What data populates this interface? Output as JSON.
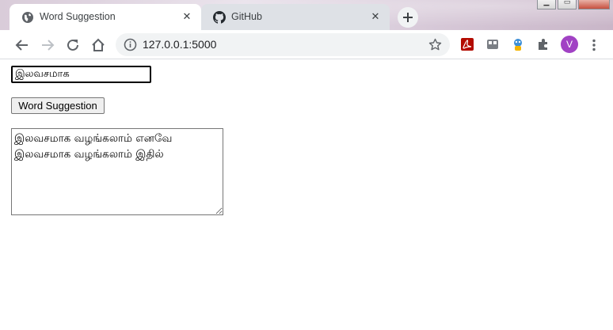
{
  "browser": {
    "tabs": [
      {
        "title": "Word Suggestion",
        "icon": "globe-icon",
        "active": true,
        "close": "✕"
      },
      {
        "title": "GitHub",
        "icon": "github-icon",
        "active": false,
        "close": "✕"
      }
    ],
    "new_tab": "+",
    "address": "127.0.0.1:5000",
    "profile_initial": "V",
    "extensions": [
      "acrobat-icon",
      "media-icon",
      "extension-avatar-icon",
      "puzzle-icon"
    ],
    "colors": {
      "avatar": "#a142c4",
      "acrobat": "#b30b00"
    }
  },
  "page": {
    "input_value": "இலவசமாக",
    "button_label": "Word Suggestion",
    "output_text": "இலவசமாக வழங்கலாம் எனவே\nஇலவசமாக வழங்கலாம் இதில்"
  }
}
